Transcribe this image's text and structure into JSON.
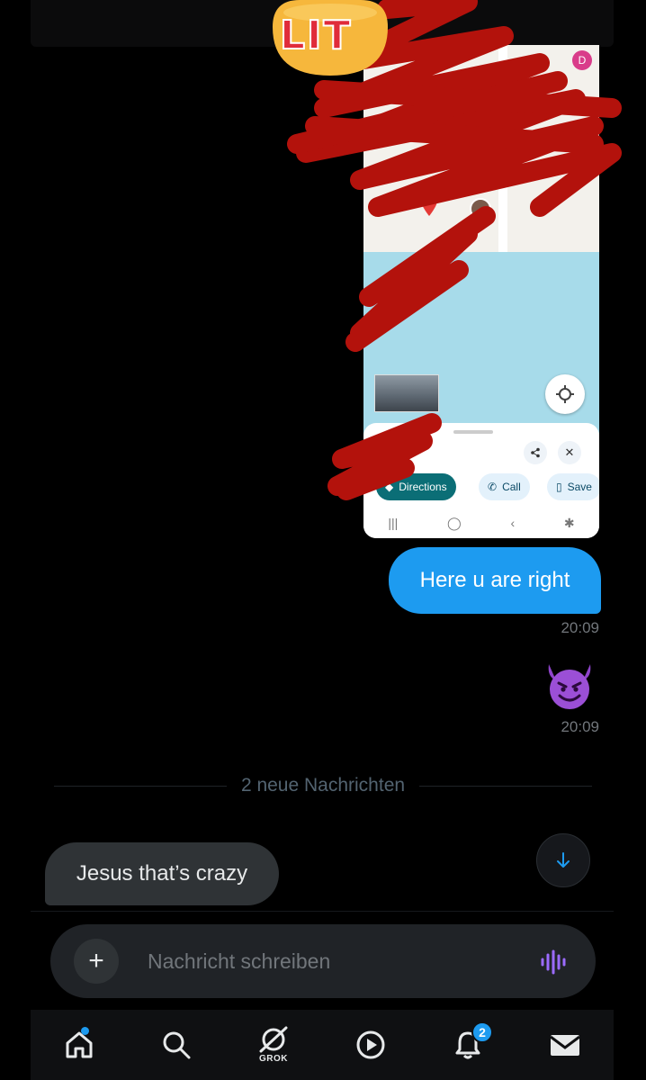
{
  "sticker": {
    "text": "LIT"
  },
  "shared_map": {
    "profile_initial": "D",
    "actions": {
      "directions": "Directions",
      "call": "Call",
      "save": "Save"
    }
  },
  "messages": [
    {
      "direction": "outgoing",
      "type": "text",
      "text": "Here u are right",
      "time": "20:09"
    },
    {
      "direction": "outgoing",
      "type": "emoji",
      "emoji": "smiling-face-with-horns",
      "time": "20:09"
    },
    {
      "direction": "incoming",
      "type": "text",
      "text": "Jesus that’s crazy"
    }
  ],
  "divider": {
    "text": "2 neue Nachrichten"
  },
  "composer": {
    "placeholder": "Nachricht schreiben"
  },
  "bottom_nav": {
    "items": [
      {
        "icon": "home-icon",
        "has_dot": true
      },
      {
        "icon": "search-icon"
      },
      {
        "icon": "grok-icon",
        "label": "GROK"
      },
      {
        "icon": "play-icon"
      },
      {
        "icon": "bell-icon",
        "badge": "2"
      },
      {
        "icon": "mail-icon"
      }
    ]
  },
  "colors": {
    "accent": "#1d9bf0",
    "background": "#000000",
    "incoming_bubble": "#2f3336",
    "muted_text": "#71767b",
    "voice_icon": "#9b6bff",
    "scribble": "#b3120c"
  }
}
